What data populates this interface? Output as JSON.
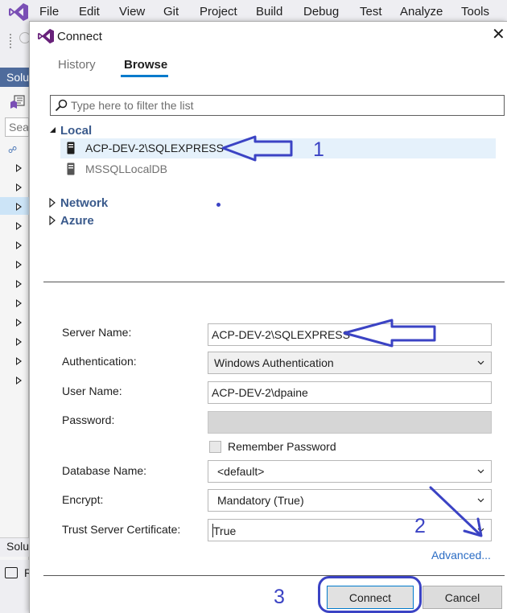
{
  "menubar": {
    "items": [
      "File",
      "Edit",
      "View",
      "Git",
      "Project",
      "Build",
      "Debug",
      "Test",
      "Analyze",
      "Tools"
    ]
  },
  "solution_explorer": {
    "header": "Solu",
    "search": "Sea",
    "footer": "Solu"
  },
  "statusbar": {
    "label": "R"
  },
  "dialog": {
    "title": "Connect",
    "tabs": [
      {
        "label": "History",
        "active": false
      },
      {
        "label": "Browse",
        "active": true
      }
    ],
    "filter": {
      "placeholder": "Type here to filter the list",
      "value": ""
    },
    "tree": {
      "local": {
        "label": "Local",
        "expanded": true,
        "servers": [
          {
            "name": "ACP-DEV-2\\SQLEXPRESS",
            "selected": true
          },
          {
            "name": "MSSQLLocalDB",
            "selected": false
          }
        ]
      },
      "network": {
        "label": "Network",
        "expanded": false
      },
      "azure": {
        "label": "Azure",
        "expanded": false
      }
    },
    "form": {
      "server_name": {
        "label": "Server Name:",
        "value": "ACP-DEV-2\\SQLEXPRESS"
      },
      "authentication": {
        "label": "Authentication:",
        "value": "Windows Authentication"
      },
      "user_name": {
        "label": "User Name:",
        "value": "ACP-DEV-2\\dpaine"
      },
      "password": {
        "label": "Password:",
        "value": ""
      },
      "remember_password": {
        "label": "Remember Password",
        "checked": false
      },
      "database_name": {
        "label": "Database Name:",
        "value": "<default>"
      },
      "encrypt": {
        "label": "Encrypt:",
        "value": "Mandatory (True)"
      },
      "trust_server_certificate": {
        "label": "Trust Server Certificate:",
        "value": "True"
      }
    },
    "advanced_link": "Advanced...",
    "buttons": {
      "connect": "Connect",
      "cancel": "Cancel"
    }
  },
  "annotations": {
    "color": "#3b43c4",
    "numbers": [
      "1",
      "2",
      "3"
    ]
  },
  "colors": {
    "accent": "#007acc",
    "group_text": "#3a5a8c",
    "selection": "#e5f1fb",
    "link": "#2a6cc4",
    "vs_purple": "#68217a"
  },
  "icons": [
    "visual-studio-logo",
    "search-icon",
    "server-icon",
    "chevron-down-icon",
    "close-icon",
    "expand-triangle-icon",
    "collapse-triangle-icon"
  ]
}
